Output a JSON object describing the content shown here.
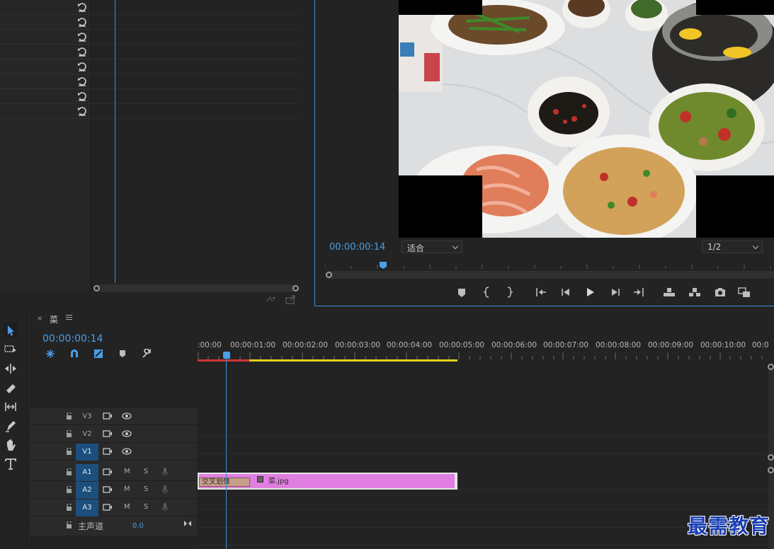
{
  "effect_controls": {
    "reset_rows": 8
  },
  "program_monitor": {
    "timecode": "00:00:00:14",
    "fit_dropdown": "适合",
    "resolution_dropdown": "1/2"
  },
  "sequence": {
    "tab_close": "×",
    "tab_name": "菜",
    "timecode": "00:00:00:14",
    "ruler_labels": [
      ":00:00",
      "00:00:01:00",
      "00:00:02:00",
      "00:00:03:00",
      "00:00:04:00",
      "00:00:05:00",
      "00:00:06:00",
      "00:00:07:00",
      "00:00:08:00",
      "00:00:09:00",
      "00:00:10:00",
      "00:0"
    ],
    "video_tracks": [
      {
        "name": "V3"
      },
      {
        "name": "V2"
      },
      {
        "name": "V1"
      }
    ],
    "audio_tracks": [
      {
        "name": "A1",
        "m": "M",
        "s": "S"
      },
      {
        "name": "A2",
        "m": "M",
        "s": "S"
      },
      {
        "name": "A3",
        "m": "M",
        "s": "S"
      }
    ],
    "master_label": "主声道",
    "master_value": "0.0",
    "clip": {
      "transition": "交叉划像",
      "name": "菜.jpg"
    }
  },
  "watermark": "最需教育",
  "colors": {
    "accent": "#3d8ee0",
    "clip": "#e17ee1",
    "work_area": "#e0d21a"
  }
}
